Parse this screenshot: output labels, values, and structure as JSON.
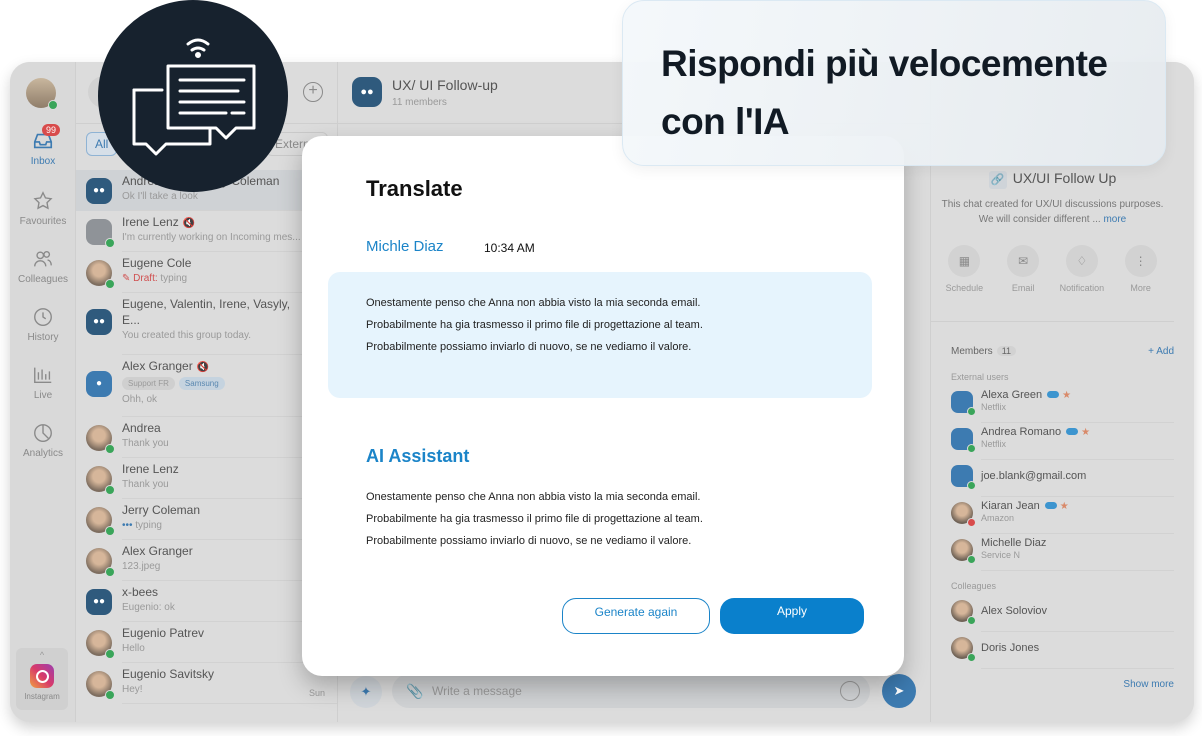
{
  "headline": {
    "line1": "Rispondi più velocemente",
    "line2": "con l'IA"
  },
  "rail": {
    "inbox_badge": "99",
    "items": [
      {
        "label": "Inbox",
        "icon": "inbox-icon"
      },
      {
        "label": "Favourites",
        "icon": "star-icon"
      },
      {
        "label": "Colleagues",
        "icon": "users-icon"
      },
      {
        "label": "History",
        "icon": "clock-icon"
      },
      {
        "label": "Live",
        "icon": "bar-chart-icon"
      },
      {
        "label": "Analytics",
        "icon": "pie-chart-icon"
      }
    ],
    "channel": {
      "label": "Instagram"
    }
  },
  "list": {
    "filters": {
      "all": "All",
      "external": "External"
    },
    "rows": [
      {
        "name": "Andrea, Irene, Jerry Coleman",
        "sub": "Ok I'll take a look"
      },
      {
        "name": "Irene Lenz",
        "sub": "I'm currently working on Incoming mes..."
      },
      {
        "name": "Eugene Cole",
        "draft": "Draft:",
        "sub": "typing"
      },
      {
        "name": "Eugene, Valentin, Irene, Vasyly,",
        "name2": "E...",
        "sub": "You created this group today."
      },
      {
        "name": "Alex Granger",
        "tags": [
          "Support FR",
          "Samsung"
        ],
        "sub": "Ohh, ok"
      },
      {
        "name": "Andrea",
        "sub": "Thank you"
      },
      {
        "name": "Irene Lenz",
        "sub": "Thank you"
      },
      {
        "name": "Jerry Coleman",
        "sub": "typing"
      },
      {
        "name": "Alex Granger",
        "sub": "123.jpeg"
      },
      {
        "name": "x-bees",
        "sub": "Eugenio: ok"
      },
      {
        "name": "Eugenio Patrev",
        "sub": "Hello"
      },
      {
        "name": "Eugenio Savitsky",
        "sub": "Hey!",
        "time": "Sun"
      }
    ]
  },
  "chat": {
    "title": "UX/ UI Follow-up",
    "subtitle": "11 members",
    "composer_placeholder": "Write a message"
  },
  "info": {
    "title": "UX/UI Follow Up",
    "desc1": "This chat created for UX/UI discussions purposes.",
    "desc2": "We will consider different ...",
    "more": "more",
    "actions": [
      "Schedule",
      "Email",
      "Notification",
      "More"
    ],
    "members_label": "Members",
    "members_count": "11",
    "add": "+ Add",
    "external_label": "External users",
    "external": [
      {
        "name": "Alexa Green",
        "org": "Netflix"
      },
      {
        "name": "Andrea Romano",
        "org": "Netflix"
      },
      {
        "name": "joe.blank@gmail.com",
        "org": ""
      },
      {
        "name": "Kiaran Jean",
        "org": "Amazon"
      },
      {
        "name": "Michelle Diaz",
        "org": "Service N"
      }
    ],
    "colleagues_label": "Colleagues",
    "colleagues": [
      {
        "name": "Alex Soloviov"
      },
      {
        "name": "Doris Jones"
      }
    ],
    "show_more": "Show more"
  },
  "modal": {
    "title": "Translate",
    "sender": "Michle Diaz",
    "time": "10:34 AM",
    "original": [
      "Onestamente penso che Anna non abbia visto la mia seconda email.",
      "Probabilmente ha gia trasmesso il primo file di progettazione al team.",
      "Probabilmente possiamo inviarlo di nuovo, se ne vediamo il valore."
    ],
    "ai_title": "AI Assistant",
    "ai_text": [
      "Onestamente penso che Anna non abbia visto la mia seconda email.",
      "Probabilmente ha gia trasmesso il primo file di progettazione al team.",
      "Probabilmente possiamo inviarlo di nuovo, se ne vediamo il valore."
    ],
    "generate_label": "Generate again",
    "apply_label": "Apply"
  },
  "colors": {
    "accent": "#0a80cc",
    "dark_badge": "#17222e",
    "online": "#3aa55a"
  }
}
